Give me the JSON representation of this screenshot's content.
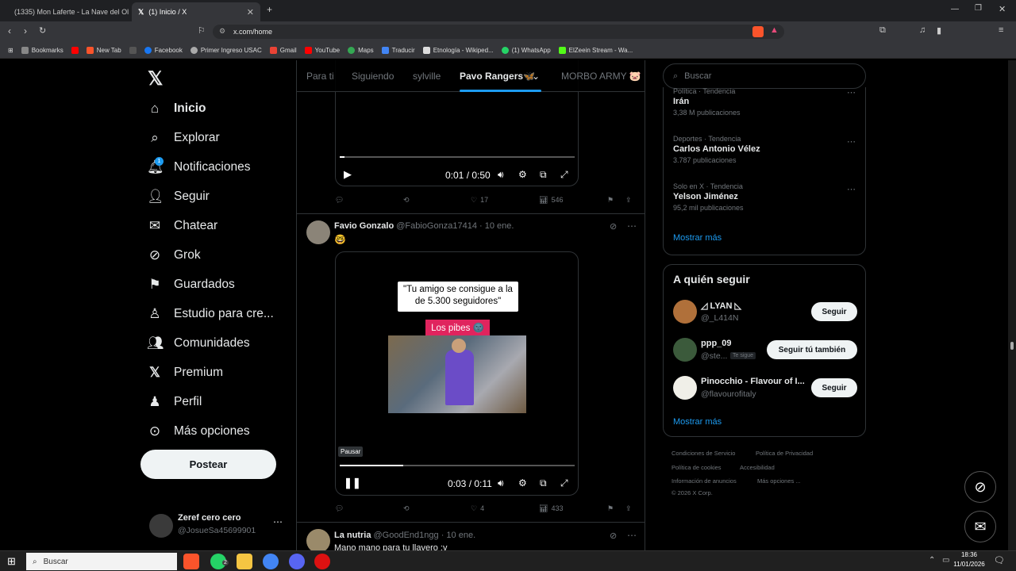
{
  "browser": {
    "tabs": [
      {
        "label": "(1335) Mon Laferte - La Nave del Ol...",
        "active": false
      },
      {
        "label": "(1) Inicio / X",
        "active": true
      }
    ],
    "url": "x.com/home",
    "bookmarks": [
      "Bookmarks",
      "New Tab",
      "Facebook",
      "Primer Ingreso USAC",
      "Gmail",
      "YouTube",
      "Maps",
      "Traducir",
      "Etnología - Wikiped...",
      "(1) WhatsApp",
      "ElZeein Stream - Wa..."
    ]
  },
  "nav": {
    "items": [
      {
        "label": "Inicio",
        "icon": "home-icon"
      },
      {
        "label": "Explorar",
        "icon": "search-icon"
      },
      {
        "label": "Notificaciones",
        "icon": "bell-icon",
        "badge": "1"
      },
      {
        "label": "Seguir",
        "icon": "add-user-icon"
      },
      {
        "label": "Chatear",
        "icon": "mail-icon"
      },
      {
        "label": "Grok",
        "icon": "grok-icon"
      },
      {
        "label": "Guardados",
        "icon": "bookmark-icon"
      },
      {
        "label": "Estudio para cre...",
        "icon": "studio-icon"
      },
      {
        "label": "Comunidades",
        "icon": "communities-icon"
      },
      {
        "label": "Premium",
        "icon": "x-logo-icon"
      },
      {
        "label": "Perfil",
        "icon": "person-icon"
      },
      {
        "label": "Más opciones",
        "icon": "more-circle-icon"
      }
    ],
    "post_label": "Postear",
    "user": {
      "name": "Zeref cero cero",
      "handle": "@JosueSa45699901"
    }
  },
  "feed": {
    "tabs": [
      "Para ti",
      "Siguiendo",
      "sylville",
      "Pavo Rangers🦋",
      "MORBO ARMY 🐷"
    ],
    "post1": {
      "time": "0:01 / 0:50",
      "likes": "17",
      "views": "546",
      "progress": 0.02
    },
    "post2": {
      "name": "Favio Gonzalo",
      "handle": "@FabioGonza17414",
      "date": "· 10 ene.",
      "text": "🤓",
      "video_caption": "\"Tu amigo se consigue a la de 5.300 seguidores\"",
      "video_tag": "Los pibes 🌚",
      "tooltip": "Pausar",
      "time": "0:03 / 0:11",
      "likes": "4",
      "views": "433",
      "progress": 0.27
    },
    "post3": {
      "name": "La nutria",
      "handle": "@GoodEnd1ngg",
      "date": "· 10 ene.",
      "text": "Mano mano para tu llavero :v"
    }
  },
  "sidebar": {
    "search_placeholder": "Buscar",
    "trends": [
      {
        "category": "Política · Tendencia",
        "title": "Irán",
        "count": "3,38 M publicaciones"
      },
      {
        "category": "Deportes · Tendencia",
        "title": "Carlos Antonio Vélez",
        "count": "3.787 publicaciones"
      },
      {
        "category": "Solo en X · Tendencia",
        "title": "Yelson Jiménez",
        "count": "95,2 mil publicaciones"
      }
    ],
    "show_more": "Mostrar más",
    "who_to_follow_title": "A quién seguir",
    "follow": [
      {
        "name": "◿ LYAN ◺",
        "handle": "@_L414N",
        "button": "Seguir"
      },
      {
        "name": "ppp_09",
        "handle": "@ste...",
        "badge": "Te sigue",
        "button": "Seguir tú también"
      },
      {
        "name": "Pinocchio - Flavour of I...",
        "handle": "@flavourofitaly",
        "button": "Seguir"
      }
    ],
    "footer": [
      "Condiciones de Servicio",
      "Política de Privacidad",
      "Política de cookies",
      "Accesibilidad",
      "Información de anuncios",
      "Más opciones ...",
      "© 2026 X Corp."
    ]
  },
  "taskbar": {
    "search": "Buscar",
    "time": "18:36",
    "date": "11/01/2026",
    "whatsapp_badge": "2"
  }
}
